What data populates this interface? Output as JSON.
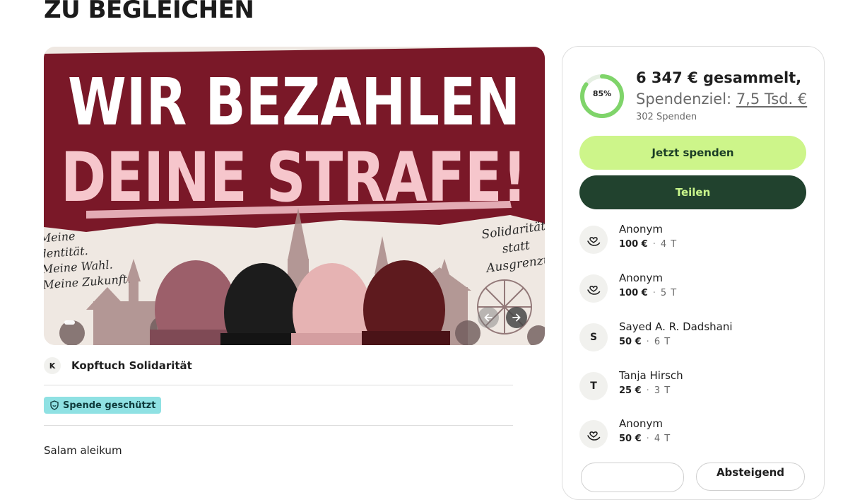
{
  "page": {
    "title": "ZU BEGLEICHEN"
  },
  "hero": {
    "headline_line1": "WIR BEZAHLEN",
    "headline_line2": "DEINE STRAFE!",
    "left_lines": [
      "Meine",
      "Identität.",
      "Meine Wahl.",
      "Meine Zukunft."
    ],
    "right_lines": [
      "Solidarität",
      "statt",
      "Ausgrenzung"
    ],
    "colors": {
      "banner": "#7a1828",
      "headline_white": "#ffffff",
      "headline_pink": "#f6c6cc"
    }
  },
  "organizer": {
    "initial": "K",
    "name": "Kopftuch Solidarität"
  },
  "badge": {
    "label": "Spende geschützt"
  },
  "story": {
    "text": "Salam aleikum"
  },
  "progress": {
    "percent": 85,
    "percent_label": "85%",
    "raised_text": "6 347 € gesammelt,",
    "goal_prefix": "Spendenziel: ",
    "goal_amount": "7,5 Tsd. €",
    "donation_count": "302 Spenden"
  },
  "buttons": {
    "donate": "Jetzt spenden",
    "share": "Teilen"
  },
  "donations": [
    {
      "name": "Anonym",
      "amount": "100 €",
      "time": "4 T",
      "avatar": "heart-hand-icon",
      "initial": ""
    },
    {
      "name": "Anonym",
      "amount": "100 €",
      "time": "5 T",
      "avatar": "heart-hand-icon",
      "initial": ""
    },
    {
      "name": "Sayed A. R. Dadshani",
      "amount": "50 €",
      "time": "6 T",
      "avatar": "initial",
      "initial": "S"
    },
    {
      "name": "Tanja Hirsch",
      "amount": "25 €",
      "time": "3 T",
      "avatar": "initial",
      "initial": "T"
    },
    {
      "name": "Anonym",
      "amount": "50 €",
      "time": "4 T",
      "avatar": "heart-hand-icon",
      "initial": ""
    }
  ],
  "sort": {
    "right_label": "Absteigend"
  },
  "colors": {
    "accent_green": "#cdf58a",
    "dark_green": "#21422e",
    "ring_green": "#7fd46a",
    "badge": "#8fe1e3"
  }
}
